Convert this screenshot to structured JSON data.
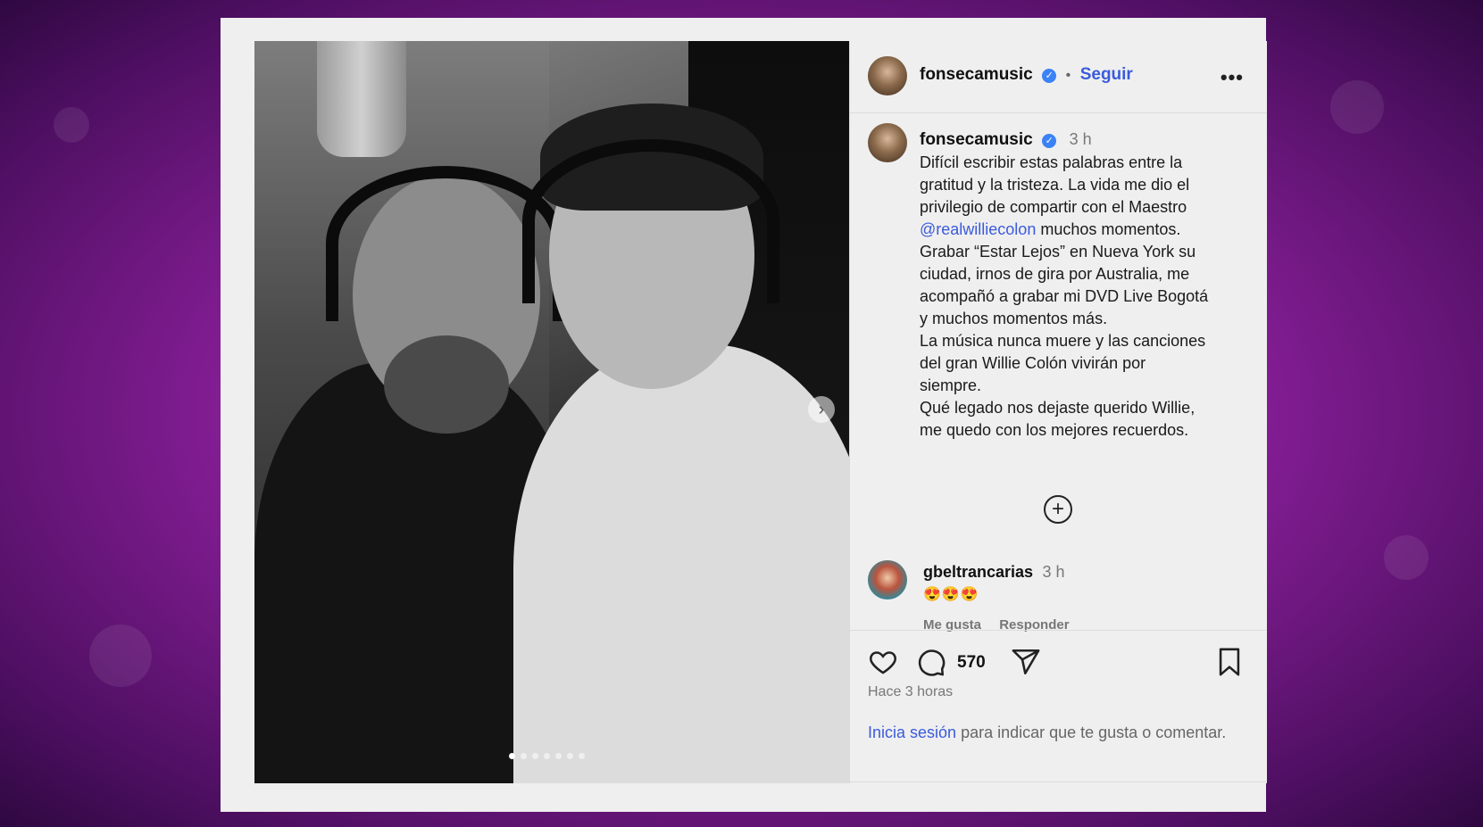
{
  "post": {
    "username": "fonsecamusic",
    "follow_label": "Seguir",
    "separator": "•",
    "more_label": "•••",
    "time": "3 h",
    "caption_lines": [
      "Difícil escribir estas palabras entre la",
      "gratitud y la tristeza. La vida me dio el",
      "privilegio de compartir con el Maestro"
    ],
    "mention": "@realwilliecolon",
    "caption_after_mention": " muchos momentos.\nGrabar “Estar Lejos” en Nueva York su\nciudad, irnos de gira por Australia, me\nacompañó a grabar mi DVD Live Bogotá\ny muchos momentos más.\nLa música nunca muere y las canciones\ndel gran Willie Colón  vivirán por\nsiempre.\nQué legado nos dejaste querido Willie,\nme quedo con los mejores recuerdos.",
    "plus_label": "+",
    "carousel": {
      "slide_count": 7,
      "active_index": 0,
      "next_arrow": "›"
    }
  },
  "comment": {
    "username": "gbeltrancarias",
    "time": "3 h",
    "text": "😍😍😍",
    "like_label": "Me gusta",
    "reply_label": "Responder"
  },
  "actions": {
    "comment_count": "570",
    "posted_ago": "Hace 3 horas"
  },
  "login_prompt": {
    "link": "Inicia sesión",
    "text": " para indicar que te gusta o comentar."
  },
  "colors": {
    "link_blue": "#3b5bdb",
    "verified_blue": "#3b82f6",
    "background_purple": "#8a1f9a"
  }
}
